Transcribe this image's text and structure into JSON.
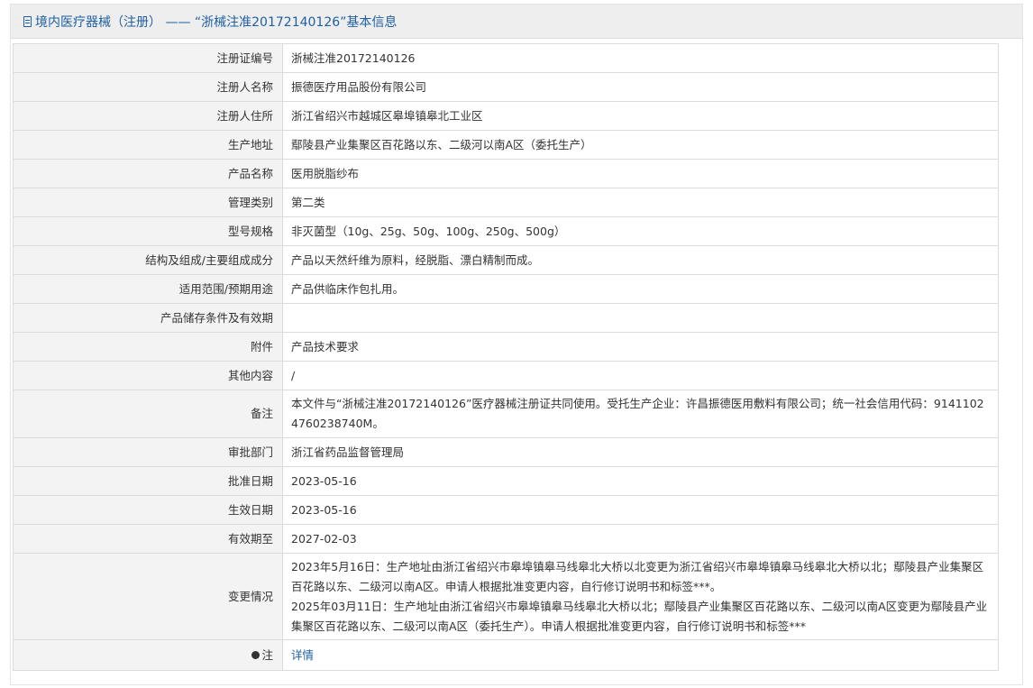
{
  "header": {
    "title": "境内医疗器械（注册） —— “浙械注准20172140126”基本信息"
  },
  "rows": [
    {
      "label": "注册证编号",
      "value": "浙械注准20172140126"
    },
    {
      "label": "注册人名称",
      "value": "振德医疗用品股份有限公司"
    },
    {
      "label": "注册人住所",
      "value": "浙江省绍兴市越城区皋埠镇皋北工业区"
    },
    {
      "label": "生产地址",
      "value": "鄢陵县产业集聚区百花路以东、二级河以南A区（委托生产）"
    },
    {
      "label": "产品名称",
      "value": "医用脱脂纱布"
    },
    {
      "label": "管理类别",
      "value": "第二类"
    },
    {
      "label": "型号规格",
      "value": "非灭菌型（10g、25g、50g、100g、250g、500g）"
    },
    {
      "label": "结构及组成/主要组成成分",
      "value": "产品以天然纤维为原料，经脱脂、漂白精制而成。"
    },
    {
      "label": "适用范围/预期用途",
      "value": "产品供临床作包扎用。"
    },
    {
      "label": "产品储存条件及有效期",
      "value": ""
    },
    {
      "label": "附件",
      "value": "产品技术要求"
    },
    {
      "label": "其他内容",
      "value": "/"
    },
    {
      "label": "备注",
      "value": "本文件与“浙械注准20172140126”医疗器械注册证共同使用。受托生产企业：许昌振德医用敷料有限公司；统一社会信用代码：91411024760238740M。"
    },
    {
      "label": "审批部门",
      "value": "浙江省药品监督管理局"
    },
    {
      "label": "批准日期",
      "value": "2023-05-16"
    },
    {
      "label": "生效日期",
      "value": "2023-05-16"
    },
    {
      "label": "有效期至",
      "value": "2027-02-03"
    }
  ],
  "change_row": {
    "label": "变更情况",
    "lines": [
      "2023年5月16日：生产地址由浙江省绍兴市皋埠镇皋马线皋北大桥以北变更为浙江省绍兴市皋埠镇皋马线皋北大桥以北；鄢陵县产业集聚区百花路以东、二级河以南A区。申请人根据批准变更内容，自行修订说明书和标签***。",
      "2025年03月11日：生产地址由浙江省绍兴市皋埠镇皋马线皋北大桥以北；鄢陵县产业集聚区百花路以东、二级河以南A区变更为鄢陵县产业集聚区百花路以东、二级河以南A区（委托生产）。申请人根据批准变更内容，自行修订说明书和标签***"
    ]
  },
  "note_row": {
    "icon": "bulb-icon",
    "label": "注",
    "link": "详情"
  },
  "colors": {
    "accent": "#1f5fa3",
    "label_bg": "#f3f3f3",
    "header_bg": "#eeeeee"
  }
}
